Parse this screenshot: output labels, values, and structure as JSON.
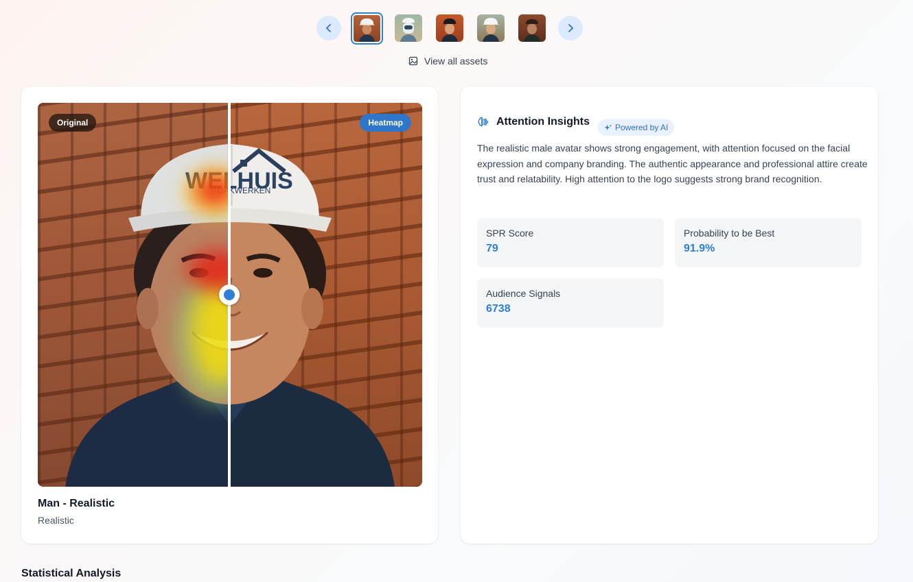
{
  "carousel": {
    "prev_icon": "chevron-left-icon",
    "next_icon": "chevron-right-icon",
    "thumbnails": [
      {
        "name": "man-realistic",
        "active": true
      },
      {
        "name": "robot"
      },
      {
        "name": "man-cartoon"
      },
      {
        "name": "man-3d"
      },
      {
        "name": "man-outdoor"
      }
    ],
    "view_all_label": "View all assets",
    "view_all_icon": "image-icon"
  },
  "compare": {
    "left_tag": "Original",
    "right_tag": "Heatmap",
    "accent": "#2f7fd6"
  },
  "asset": {
    "title": "Man - Realistic",
    "subtitle": "Realistic"
  },
  "insights": {
    "icon": "brain-icon",
    "title": "Attention Insights",
    "badge": "Powered by AI",
    "badge_icon": "sparkle-icon",
    "text": "The realistic male avatar shows strong engagement, with attention focused on the facial expression and company branding. The authentic appearance and professional attire create trust and relatability. High attention to the logo suggests strong brand recognition.",
    "metrics": [
      {
        "label": "SPR Score",
        "value": "79"
      },
      {
        "label": "Probability to be Best",
        "value": "91.9%"
      },
      {
        "label": "Audience Signals",
        "value": "6738"
      }
    ]
  },
  "section": {
    "title": "Statistical Analysis"
  }
}
